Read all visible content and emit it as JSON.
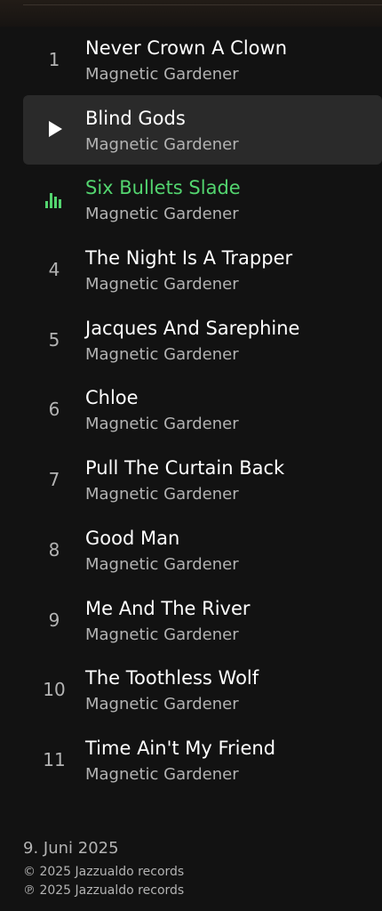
{
  "tracks": [
    {
      "number": "1",
      "title": "Never Crown A Clown",
      "artist": "Magnetic Gardener",
      "state": "normal"
    },
    {
      "number": "",
      "title": "Blind Gods",
      "artist": "Magnetic Gardener",
      "state": "hover"
    },
    {
      "number": "",
      "title": "Six Bullets Slade",
      "artist": "Magnetic Gardener",
      "state": "playing"
    },
    {
      "number": "4",
      "title": "The Night Is A Trapper",
      "artist": "Magnetic Gardener",
      "state": "normal"
    },
    {
      "number": "5",
      "title": "Jacques And Sarephine",
      "artist": "Magnetic Gardener",
      "state": "normal"
    },
    {
      "number": "6",
      "title": "Chloe",
      "artist": "Magnetic Gardener",
      "state": "normal"
    },
    {
      "number": "7",
      "title": "Pull The Curtain Back",
      "artist": "Magnetic Gardener",
      "state": "normal"
    },
    {
      "number": "8",
      "title": "Good Man",
      "artist": "Magnetic Gardener",
      "state": "normal"
    },
    {
      "number": "9",
      "title": "Me And The River",
      "artist": "Magnetic Gardener",
      "state": "normal"
    },
    {
      "number": "10",
      "title": "The Toothless Wolf",
      "artist": "Magnetic Gardener",
      "state": "normal"
    },
    {
      "number": "11",
      "title": "Time Ain't My Friend",
      "artist": "Magnetic Gardener",
      "state": "normal"
    }
  ],
  "icons": {
    "hover": "play-icon",
    "playing": "equalizer-icon"
  },
  "colors": {
    "background": "#121212",
    "accent": "#53d46f",
    "secondary_text": "#b3b3b3",
    "hover_row": "#2a2a2a"
  },
  "footer": {
    "release_date": "9. Juni 2025",
    "copyright": "© 2025 Jazzualdo records",
    "phonographic": "℗ 2025 Jazzualdo records"
  }
}
